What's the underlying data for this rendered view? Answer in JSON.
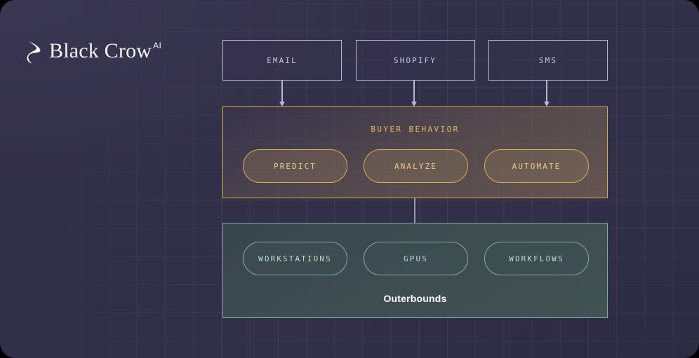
{
  "brand": {
    "logo_mark": "crow-mark-icon",
    "wordmark": "Black Crow",
    "superscript": "AI"
  },
  "colors": {
    "canvas_background": "#322f48",
    "grid_line": "#a8a6c4",
    "source_border": "#b9b5d6",
    "source_text": "#c6c2e0",
    "gold_accent": "#d9ae4e",
    "gold_text": "#e6b75c",
    "gold_pill_text": "#f0cb81",
    "teal_accent": "#7fae9f",
    "teal_text": "#b9ded1",
    "caption_text": "#ffffff"
  },
  "sources": {
    "items": [
      {
        "label": "EMAIL"
      },
      {
        "label": "SHOPIFY"
      },
      {
        "label": "SMS"
      }
    ]
  },
  "connectors": {
    "email_to_buyer": "arrow-down",
    "shopify_to_buyer": "arrow-down",
    "sms_to_buyer": "arrow-down",
    "buyer_to_outerbounds": "line-down"
  },
  "buyer_behavior": {
    "title": "BUYER BEHAVIOR",
    "capabilities": [
      {
        "label": "PREDICT"
      },
      {
        "label": "ANALYZE"
      },
      {
        "label": "AUTOMATE"
      }
    ]
  },
  "outerbounds": {
    "caption": "Outerbounds",
    "resources": [
      {
        "label": "WORKSTATIONS"
      },
      {
        "label": "GPUS"
      },
      {
        "label": "WORKFLOWS"
      }
    ]
  }
}
